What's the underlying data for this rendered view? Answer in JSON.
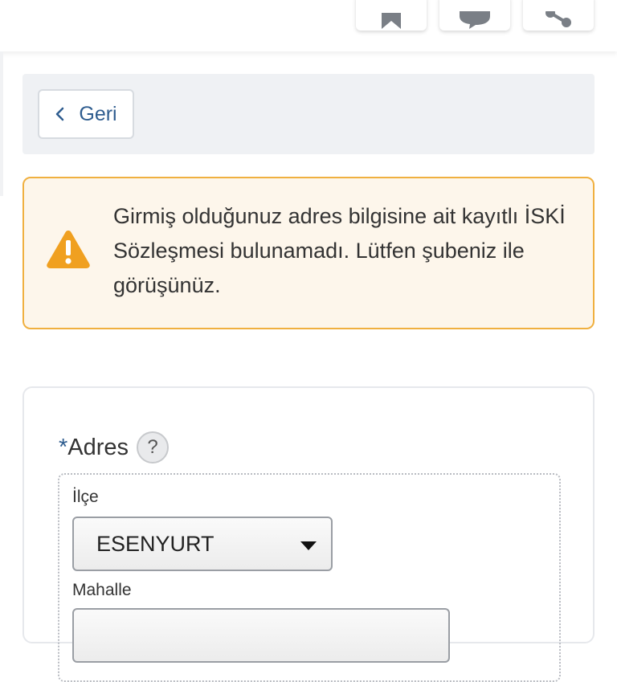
{
  "toolbar": {
    "icons": [
      "bookmark-icon",
      "comment-icon",
      "share-icon"
    ]
  },
  "back": {
    "label": "Geri",
    "icon": "chevron-left-icon"
  },
  "warning": {
    "icon": "warning-triangle-icon",
    "message": "Girmiş olduğunuz adres bilgisine ait kayıtlı İSKİ Sözleşmesi bulunamadı. Lütfen şubeniz ile görüşünüz.",
    "color": "#f0b040"
  },
  "form": {
    "address": {
      "required_mark": "*",
      "label": "Adres",
      "help": "?",
      "district_label": "İlçe",
      "district_value": "ESENYURT",
      "neighborhood_label": "Mahalle",
      "neighborhood_value": ""
    }
  },
  "colors": {
    "accent": "#2f5d8f",
    "warning_border": "#f0b040",
    "warning_bg": "#fdf6eb"
  }
}
